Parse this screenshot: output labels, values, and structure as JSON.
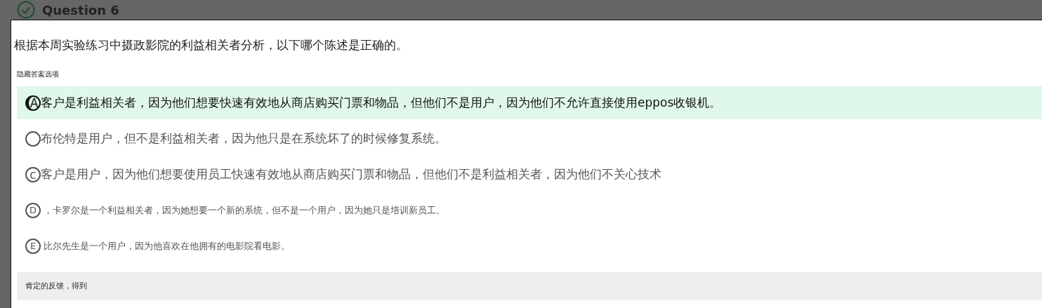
{
  "header": {
    "title": "Question 6"
  },
  "question": "根据本周实验练习中摄政影院的利益相关者分析，以下哪个陈述是正确的。",
  "hide_link": "隐藏答案选项",
  "options": [
    {
      "kind": "large",
      "letter": "A",
      "text": "客户是利益相关者，因为他们想要快速有效地从商店购买门票和物品，但他们不是用户，因为他们不允许直接使用eppos收银机。",
      "selected": true
    },
    {
      "kind": "large",
      "text": "布伦特是用户，但不是利益相关者，因为他只是在系统坏了的时候修复系统。",
      "selected": false
    },
    {
      "kind": "large",
      "letter": "c",
      "text": "客户是用户，因为他们想要使用员工快速有效地从商店购买门票和物品，但他们不是利益相关者，因为他们不关心技术",
      "selected": false
    },
    {
      "kind": "small",
      "letter": "D",
      "text": "，卡罗尔是一个利益相关者，因为她想要一个新的系统，但不是一个用户，因为她只是培训新员工。",
      "selected": false
    },
    {
      "kind": "small",
      "letter": "E",
      "text": "比尔先生是一个用户，因为他喜欢在他拥有的电影院看电影。",
      "selected": false
    }
  ],
  "feedback": "肯定的反馈，得到"
}
